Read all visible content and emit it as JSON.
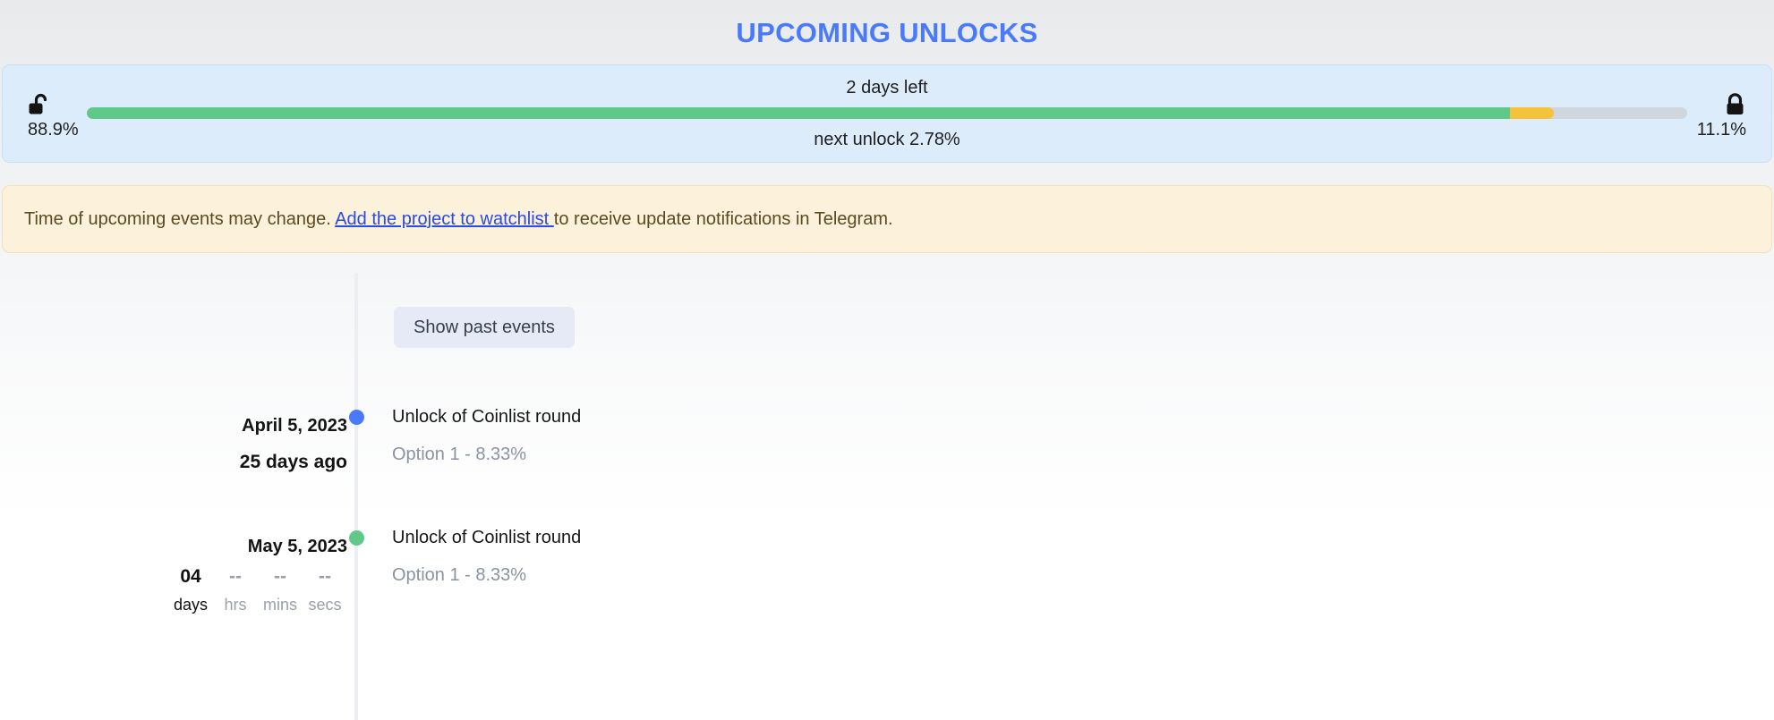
{
  "header": {
    "title": "UPCOMING UNLOCKS",
    "title_color": "#4a7afc"
  },
  "unlock_progress": {
    "unlocked_icon": "unlock-open-icon",
    "unlocked_percent_label": "88.9%",
    "locked_icon": "lock-closed-icon",
    "locked_percent_label": "11.1%",
    "time_left_label": "2 days left",
    "next_unlock_label": "next unlock 2.78%",
    "unlocked_percent_value": 88.9,
    "next_unlock_percent_value": 2.78,
    "locked_percent_value": 11.1,
    "colors": {
      "unlocked": "#5fc98a",
      "next_unlock": "#f5c33b",
      "locked_track": "#cfd6dd",
      "panel_background": "#ddecfb"
    }
  },
  "notice": {
    "text_before": "Time of upcoming events may change. ",
    "link_text": "Add the project to watchlist ",
    "text_after": "to receive update notifications in Telegram.",
    "link_color": "#2b4ae0",
    "background": "#fcf1da"
  },
  "timeline": {
    "show_past_button": "Show past events",
    "events": [
      {
        "date": "April 5, 2023",
        "relative": "25 days ago",
        "dot_color": "#4a7afc",
        "title": "Unlock of Coinlist round",
        "subtitle": "Option 1 - 8.33%"
      },
      {
        "date": "May 5, 2023",
        "dot_color": "#5fc98a",
        "title": "Unlock of Coinlist round",
        "subtitle": "Option 1 - 8.33%",
        "countdown": {
          "days_value": "04",
          "days_label": "days",
          "hrs_value": "--",
          "hrs_label": "hrs",
          "mins_value": "--",
          "mins_label": "mins",
          "secs_value": "--",
          "secs_label": "secs"
        }
      }
    ]
  }
}
